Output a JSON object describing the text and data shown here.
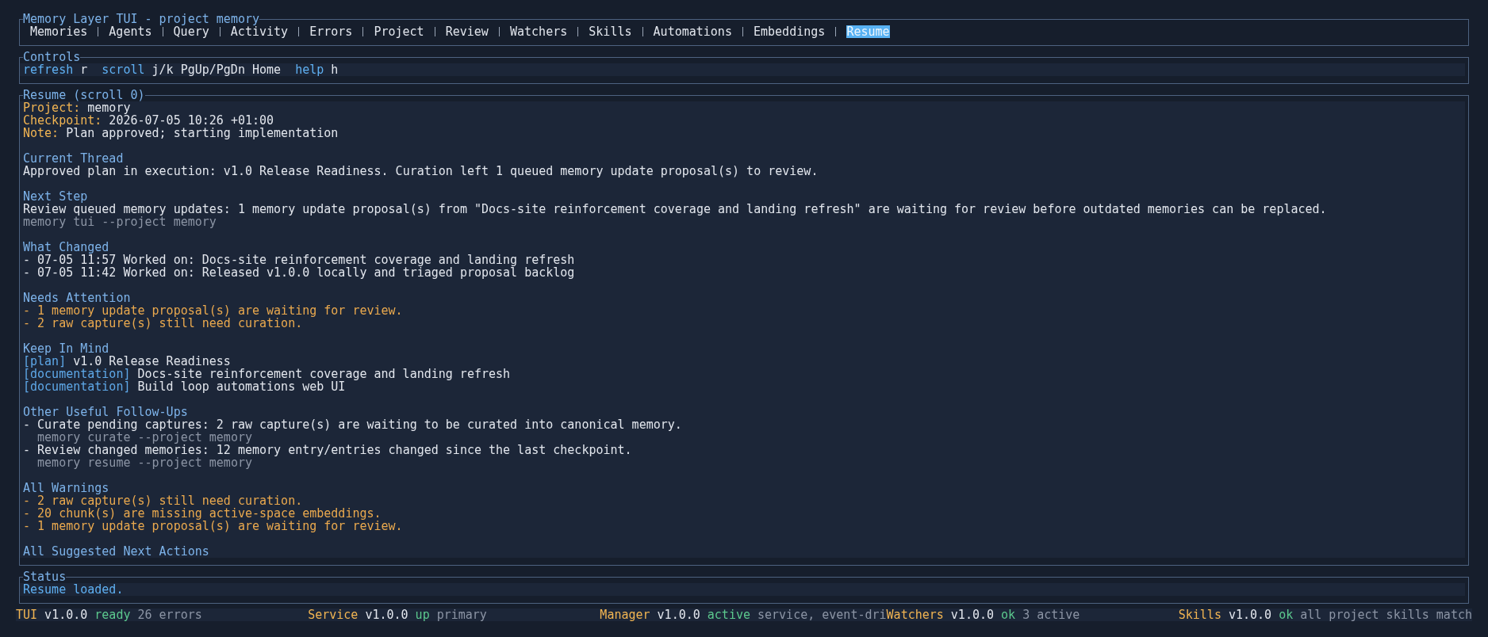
{
  "window": {
    "title": "Memory Layer TUI - project memory"
  },
  "tabs": [
    {
      "label": "Memories",
      "selected": false
    },
    {
      "label": "Agents",
      "selected": false
    },
    {
      "label": "Query",
      "selected": false
    },
    {
      "label": "Activity",
      "selected": false
    },
    {
      "label": "Errors",
      "selected": false
    },
    {
      "label": "Project",
      "selected": false
    },
    {
      "label": "Review",
      "selected": false
    },
    {
      "label": "Watchers",
      "selected": false
    },
    {
      "label": "Skills",
      "selected": false
    },
    {
      "label": "Automations",
      "selected": false
    },
    {
      "label": "Embeddings",
      "selected": false
    },
    {
      "label": "Resume",
      "selected": true
    }
  ],
  "controls": {
    "title": "Controls",
    "hints": [
      {
        "action": "refresh",
        "keys": "r"
      },
      {
        "action": "scroll",
        "keys": "j/k PgUp/PgDn Home"
      },
      {
        "action": "help",
        "keys": "h"
      }
    ]
  },
  "resume": {
    "title": "Resume (scroll 0)",
    "fields": [
      {
        "label": "Project:",
        "value": "memory"
      },
      {
        "label": "Checkpoint:",
        "value": "2026-07-05 10:26 +01:00"
      },
      {
        "label": "Note:",
        "value": "Plan approved; starting implementation"
      }
    ],
    "sections": [
      {
        "heading": "Current Thread",
        "lines": [
          {
            "kind": "text",
            "text": "Approved plan in execution: v1.0 Release Readiness. Curation left 1 queued memory update proposal(s) to review."
          }
        ]
      },
      {
        "heading": "Next Step",
        "lines": [
          {
            "kind": "text",
            "text": "Review queued memory updates: 1 memory update proposal(s) from \"Docs-site reinforcement coverage and landing refresh\" are waiting for review before outdated memories can be replaced."
          },
          {
            "kind": "command",
            "text": "memory tui --project memory"
          }
        ]
      },
      {
        "heading": "What Changed",
        "lines": [
          {
            "kind": "text",
            "text": "- 07-05 11:57 Worked on: Docs-site reinforcement coverage and landing refresh"
          },
          {
            "kind": "text",
            "text": "- 07-05 11:42 Worked on: Released v1.0.0 locally and triaged proposal backlog"
          }
        ]
      },
      {
        "heading": "Needs Attention",
        "lines": [
          {
            "kind": "warning",
            "text": "- 1 memory update proposal(s) are waiting for review."
          },
          {
            "kind": "warning",
            "text": "- 2 raw capture(s) still need curation."
          }
        ]
      },
      {
        "heading": "Keep In Mind",
        "lines": [
          {
            "kind": "tagged",
            "tag": "[plan]",
            "text": "v1.0 Release Readiness"
          },
          {
            "kind": "tagged",
            "tag": "[documentation]",
            "text": "Docs-site reinforcement coverage and landing refresh"
          },
          {
            "kind": "tagged",
            "tag": "[documentation]",
            "text": "Build loop automations web UI"
          }
        ]
      },
      {
        "heading": "Other Useful Follow-Ups",
        "lines": [
          {
            "kind": "text",
            "text": "- Curate pending captures: 2 raw capture(s) are waiting to be curated into canonical memory.",
            "children": [
              {
                "kind": "command",
                "text": "memory curate --project memory"
              }
            ]
          },
          {
            "kind": "text",
            "text": "- Review changed memories: 12 memory entry/entries changed since the last checkpoint.",
            "children": [
              {
                "kind": "command",
                "text": "memory resume --project memory"
              }
            ]
          }
        ]
      },
      {
        "heading": "All Warnings",
        "lines": [
          {
            "kind": "warning",
            "text": "- 2 raw capture(s) still need curation."
          },
          {
            "kind": "warning",
            "text": "- 20 chunk(s) are missing active-space embeddings."
          },
          {
            "kind": "warning",
            "text": "- 1 memory update proposal(s) are waiting for review."
          }
        ]
      },
      {
        "heading": "All Suggested Next Actions"
      }
    ]
  },
  "status": {
    "title": "Status",
    "message": "Resume loaded."
  },
  "status_bar": [
    {
      "name": "TUI",
      "version": "v1.0.0",
      "state": "ready",
      "detail": "26 errors"
    },
    {
      "name": "Service",
      "version": "v1.0.0",
      "state": "up",
      "detail": "primary"
    },
    {
      "name": "Manager",
      "version": "v1.0.0",
      "state": "active",
      "detail": "service, event-dri"
    },
    {
      "name": "Watchers",
      "version": "v1.0.0",
      "state": "ok",
      "detail": "3 active"
    },
    {
      "name": "Skills",
      "version": "v1.0.0",
      "state": "ok",
      "detail": "all project skills match"
    }
  ]
}
